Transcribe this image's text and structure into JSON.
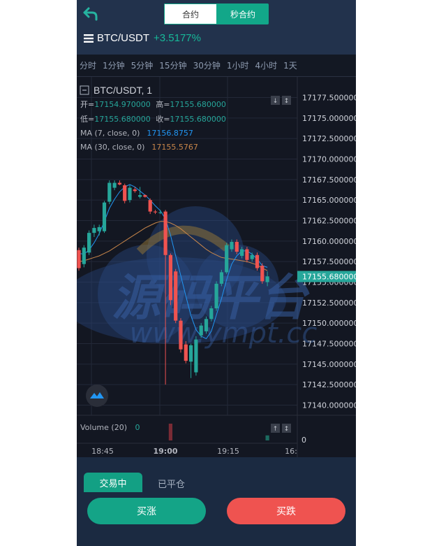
{
  "header": {
    "tab_contract": "合约",
    "tab_second_contract": "秒合约",
    "pair": "BTC/USDT",
    "change": "+3.5177%"
  },
  "intervals": [
    "分时",
    "1分钟",
    "5分钟",
    "15分钟",
    "30分钟",
    "1小时",
    "4小时",
    "1天"
  ],
  "chart_data": {
    "type": "candlestick",
    "title": "BTC/USDT, 1",
    "ohlc": {
      "open_label": "开=",
      "open": "17154.970000",
      "high_label": "高=",
      "high": "17155.680000",
      "low_label": "低=",
      "low": "17155.680000",
      "close_label": "收=",
      "close": "17155.680000"
    },
    "ma7_label": "MA (7, close, 0)",
    "ma7_value": "17156.8757",
    "ma30_label": "MA (30, close, 0)",
    "ma30_value": "17155.5767",
    "price_ticks": [
      "17177.500000",
      "17175.000000",
      "17172.500000",
      "17170.000000",
      "17167.500000",
      "17165.000000",
      "17162.500000",
      "17160.000000",
      "17157.500000",
      "17155.000000",
      "17152.500000",
      "17150.000000",
      "17147.500000",
      "17145.000000",
      "17142.500000",
      "17140.000000"
    ],
    "current_price": "17155.680000",
    "ylim": [
      17138.75,
      17178.75
    ],
    "time_ticks": [
      "18:45",
      "19:00",
      "19:15",
      "16:"
    ],
    "volume_label": "Volume (20)",
    "volume_value": "0",
    "volume_tick": "0",
    "watermark": "源码平台 www.ympt.cc",
    "candles": [
      {
        "o": 17158.9,
        "h": 17159.2,
        "l": 17156.4,
        "c": 17156.7
      },
      {
        "o": 17157.2,
        "h": 17159.5,
        "l": 17156.8,
        "c": 17159.2
      },
      {
        "o": 17158.6,
        "h": 17161.3,
        "l": 17158.3,
        "c": 17161.0
      },
      {
        "o": 17161.0,
        "h": 17162.0,
        "l": 17160.5,
        "c": 17161.6
      },
      {
        "o": 17161.2,
        "h": 17162.0,
        "l": 17160.7,
        "c": 17161.7
      },
      {
        "o": 17161.2,
        "h": 17164.9,
        "l": 17161.0,
        "c": 17164.7
      },
      {
        "o": 17164.8,
        "h": 17167.4,
        "l": 17164.5,
        "c": 17167.1
      },
      {
        "o": 17166.5,
        "h": 17167.4,
        "l": 17166.2,
        "c": 17167.1
      },
      {
        "o": 17167.1,
        "h": 17167.4,
        "l": 17166.8,
        "c": 17166.9
      },
      {
        "o": 17166.8,
        "h": 17167.0,
        "l": 17164.6,
        "c": 17164.9
      },
      {
        "o": 17165.0,
        "h": 17166.8,
        "l": 17164.7,
        "c": 17166.5
      },
      {
        "o": 17166.3,
        "h": 17166.6,
        "l": 17165.9,
        "c": 17166.1
      },
      {
        "o": 17165.4,
        "h": 17166.6,
        "l": 17165.2,
        "c": 17165.6
      },
      {
        "o": 17165.6,
        "h": 17165.7,
        "l": 17165.3,
        "c": 17165.4
      },
      {
        "o": 17165.0,
        "h": 17165.2,
        "l": 17163.3,
        "c": 17163.6
      },
      {
        "o": 17163.6,
        "h": 17163.8,
        "l": 17163.3,
        "c": 17163.5
      },
      {
        "o": 17163.5,
        "h": 17163.8,
        "l": 17163.3,
        "c": 17163.5
      },
      {
        "o": 17163.6,
        "h": 17163.8,
        "l": 17142.5,
        "c": 17158.3
      },
      {
        "o": 17158.3,
        "h": 17158.5,
        "l": 17152.2,
        "c": 17152.8
      },
      {
        "o": 17156.3,
        "h": 17156.6,
        "l": 17150.0,
        "c": 17150.3
      },
      {
        "o": 17150.3,
        "h": 17150.6,
        "l": 17146.4,
        "c": 17146.8
      },
      {
        "o": 17147.4,
        "h": 17147.8,
        "l": 17145.1,
        "c": 17145.4
      },
      {
        "o": 17145.3,
        "h": 17147.5,
        "l": 17143.3,
        "c": 17147.3
      },
      {
        "o": 17144.0,
        "h": 17148.4,
        "l": 17143.6,
        "c": 17148.0
      },
      {
        "o": 17148.5,
        "h": 17150.0,
        "l": 17148.2,
        "c": 17149.7
      },
      {
        "o": 17149.0,
        "h": 17150.8,
        "l": 17148.7,
        "c": 17150.5
      },
      {
        "o": 17150.5,
        "h": 17152.1,
        "l": 17150.2,
        "c": 17151.8
      },
      {
        "o": 17151.8,
        "h": 17155.1,
        "l": 17151.5,
        "c": 17154.8
      },
      {
        "o": 17154.8,
        "h": 17156.5,
        "l": 17154.5,
        "c": 17156.2
      },
      {
        "o": 17156.2,
        "h": 17159.8,
        "l": 17156.0,
        "c": 17159.5
      },
      {
        "o": 17159.0,
        "h": 17160.2,
        "l": 17158.7,
        "c": 17159.9
      },
      {
        "o": 17159.9,
        "h": 17160.2,
        "l": 17158.4,
        "c": 17158.7
      },
      {
        "o": 17158.2,
        "h": 17159.3,
        "l": 17157.9,
        "c": 17159.0
      },
      {
        "o": 17159.0,
        "h": 17159.3,
        "l": 17157.4,
        "c": 17157.7
      },
      {
        "o": 17157.8,
        "h": 17158.6,
        "l": 17157.5,
        "c": 17158.3
      },
      {
        "o": 17158.3,
        "h": 17158.6,
        "l": 17156.4,
        "c": 17156.7
      },
      {
        "o": 17157.0,
        "h": 17157.3,
        "l": 17154.8,
        "c": 17155.1
      },
      {
        "o": 17155.0,
        "h": 17156.3,
        "l": 17154.5,
        "c": 17155.7
      }
    ],
    "ma7": [
      17158.5,
      17158.4,
      17158.9,
      17159.8,
      17160.9,
      17162.4,
      17164.0,
      17165.1,
      17166.0,
      17166.6,
      17166.9,
      17166.6,
      17166.1,
      17165.6,
      17165.0,
      17164.3,
      17163.7,
      17162.7,
      17160.7,
      17158.2,
      17155.8,
      17153.3,
      17150.9,
      17149.2,
      17148.4,
      17148.1,
      17149.0,
      17151.0,
      17153.0,
      17155.3,
      17157.2,
      17158.2,
      17158.8,
      17158.8,
      17158.4,
      17157.8,
      17157.0,
      17156.8
    ],
    "ma30": [
      17157.5,
      17157.6,
      17157.8,
      17158.0,
      17158.2,
      17158.5,
      17158.8,
      17159.2,
      17159.6,
      17160.0,
      17160.4,
      17160.8,
      17161.2,
      17161.6,
      17161.9,
      17162.2,
      17162.4,
      17162.4,
      17162.2,
      17161.9,
      17161.5,
      17161.0,
      17160.5,
      17160.0,
      17159.5,
      17159.0,
      17158.6,
      17158.3,
      17158.0,
      17157.9,
      17157.8,
      17157.7,
      17157.6,
      17157.5,
      17157.3,
      17157.1,
      17156.7,
      17156.4
    ],
    "volumes": [
      0,
      0,
      0,
      0,
      0,
      0,
      0,
      0,
      0,
      0,
      0,
      0,
      0,
      0,
      0,
      0,
      0,
      0,
      1.0,
      0,
      0,
      0,
      0,
      0,
      0,
      0,
      0,
      0,
      0,
      0,
      0,
      0,
      0,
      0,
      0,
      0,
      0,
      0.3,
      0,
      0
    ],
    "colors": {
      "up": "#26a69a",
      "down": "#ef5350",
      "ma7": "#2196f3",
      "ma30": "#c8864a",
      "background": "#131722",
      "grid": "#232838",
      "price_tag": "#26a69a"
    }
  },
  "bottom": {
    "tab_trading": "交易中",
    "tab_closed": "已平仓",
    "buy_label": "买涨",
    "sell_label": "买跌"
  }
}
